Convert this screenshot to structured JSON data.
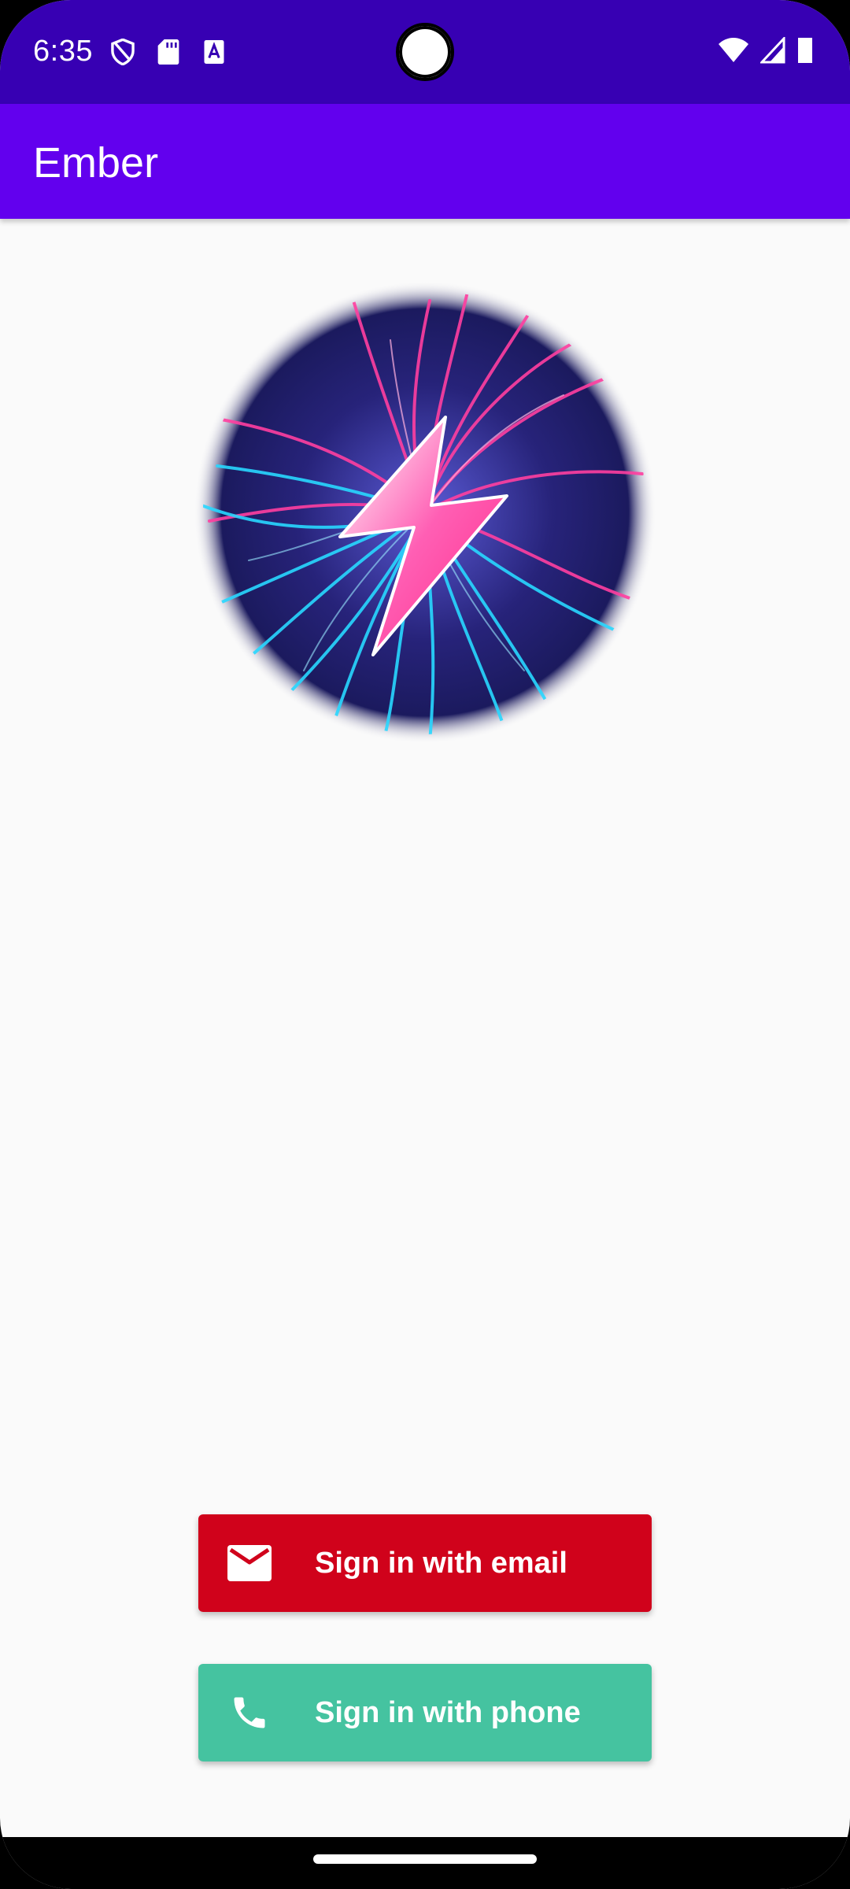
{
  "status_bar": {
    "time": "6:35",
    "left_icons": [
      "shield-icon",
      "sd-card-icon",
      "text-recognition-icon"
    ],
    "right_icons": [
      "wifi-icon",
      "cellular-signal-icon",
      "battery-icon"
    ]
  },
  "app_bar": {
    "title": "Ember"
  },
  "logo": {
    "icon": "lightning-bolt-logo",
    "colors": {
      "pink": "#ff3fa0",
      "cyan": "#28d8ff",
      "dark_blue": "#1b1a5e"
    }
  },
  "buttons": {
    "email": {
      "label": "Sign in with email",
      "icon": "mail-icon",
      "color": "#d0021b"
    },
    "phone": {
      "label": "Sign in with phone",
      "icon": "phone-icon",
      "color": "#45c3a0"
    }
  },
  "colors": {
    "status_bar": "#3700b3",
    "app_bar": "#6200ee",
    "background": "#fafafa"
  }
}
